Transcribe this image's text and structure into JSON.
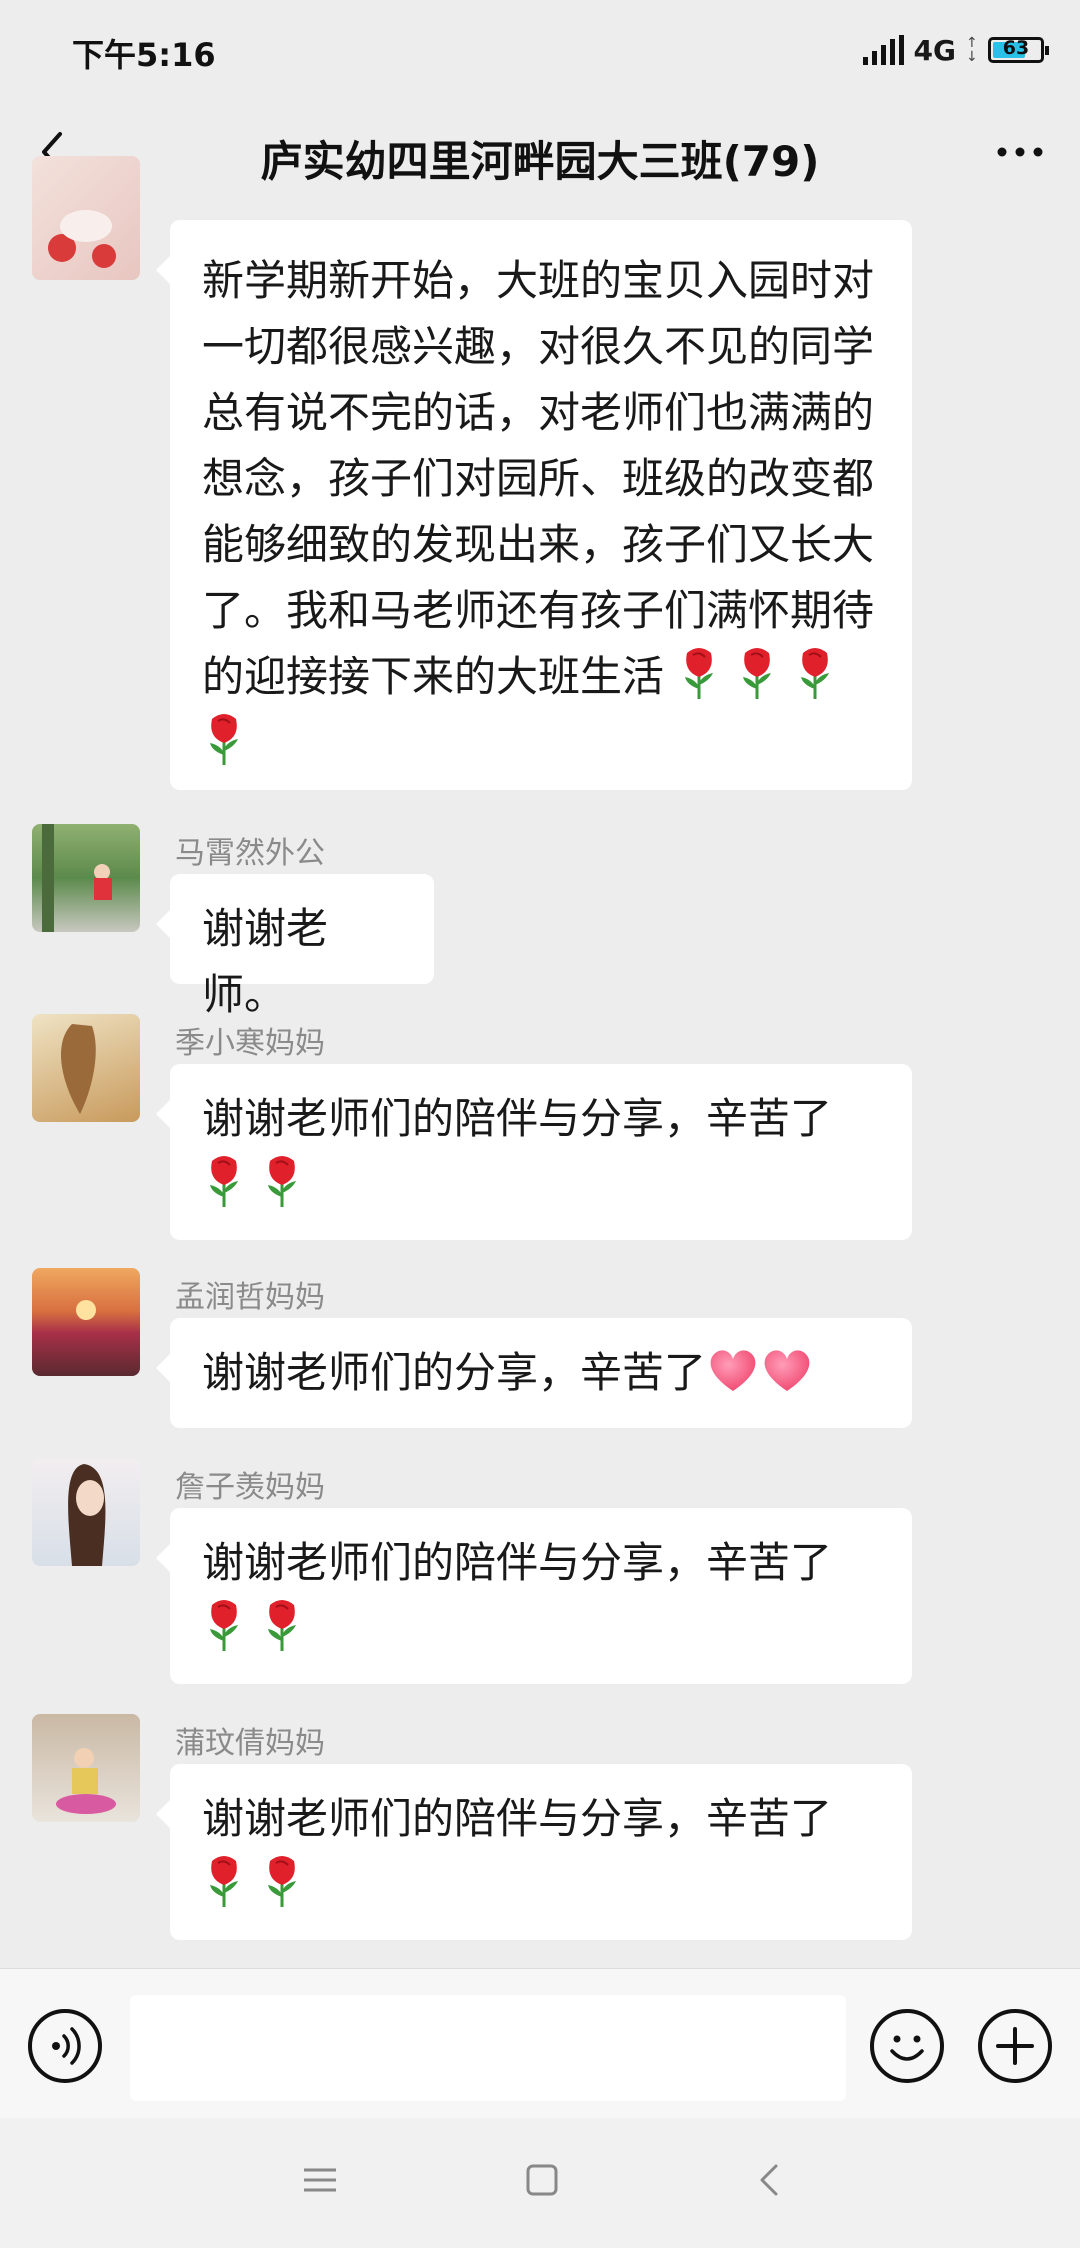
{
  "status_bar": {
    "time": "下午5:16",
    "network": "4G",
    "battery": "63",
    "battery_level": 0.63
  },
  "header": {
    "title": "庐实幼四里河畔园大三班(79)",
    "back_icon": "chevron-left-icon",
    "more_icon": "more-dots-icon"
  },
  "messages": [
    {
      "sender": "",
      "text": "新学期新开始，大班的宝贝入园时对一切都很感兴趣，对很久不见的同学总有说不完的话，对老师们也满满的想念，孩子们对园所、班级的改变都能够细致的发现出来，孩子们又长大了。我和马老师还有孩子们满怀期待的迎接接下来的大班生活",
      "roses": 4,
      "hearts": 0
    },
    {
      "sender": "马霄然外公",
      "text": "谢谢老师。",
      "roses": 0,
      "hearts": 0
    },
    {
      "sender": "季小寒妈妈",
      "text": "谢谢老师们的陪伴与分享，辛苦了",
      "roses": 2,
      "hearts": 0
    },
    {
      "sender": "孟润哲妈妈",
      "text": "谢谢老师们的分享，辛苦了",
      "roses": 0,
      "hearts": 2
    },
    {
      "sender": "詹子羡妈妈",
      "text": "谢谢老师们的陪伴与分享，辛苦了",
      "roses": 2,
      "hearts": 0
    },
    {
      "sender": "蒲玟倩妈妈",
      "text": "谢谢老师们的陪伴与分享，辛苦了",
      "roses": 2,
      "hearts": 0
    }
  ],
  "input_bar": {
    "voice_icon": "voice-icon",
    "emoji_icon": "emoji-icon",
    "plus_icon": "plus-icon",
    "value": ""
  },
  "system_nav": {
    "menu_icon": "menu-icon",
    "home_icon": "home-icon",
    "back_icon": "back-icon"
  },
  "colors": {
    "background": "#ededed",
    "bubble": "#ffffff",
    "sender": "#8a8a8a",
    "battery": "#29c1e8"
  }
}
